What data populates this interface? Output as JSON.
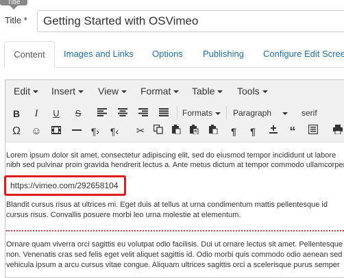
{
  "tooltip": {
    "text": "Title"
  },
  "title_field": {
    "label": "Title *",
    "value": "Getting Started with OSVimeo"
  },
  "tabs": [
    {
      "label": "Content",
      "active": true
    },
    {
      "label": "Images and Links",
      "active": false
    },
    {
      "label": "Options",
      "active": false
    },
    {
      "label": "Publishing",
      "active": false
    },
    {
      "label": "Configure Edit Screen",
      "active": false
    }
  ],
  "editor": {
    "menubar": [
      {
        "label": "Edit"
      },
      {
        "label": "Insert"
      },
      {
        "label": "View"
      },
      {
        "label": "Format"
      },
      {
        "label": "Table"
      },
      {
        "label": "Tools"
      }
    ],
    "toolbar": {
      "bold": "B",
      "italic": "I",
      "underline": "U",
      "strikethrough": "S",
      "formats_label": "Formats",
      "block_label": "Paragraph",
      "font_label": "serif"
    },
    "content": {
      "para1_line1": "Lorem ipsum dolor sit amet, consectetur adipiscing elit, sed do eiusmod tempor incididunt ut labore",
      "para1_line2": "nibh sed pulvinar proin gravida hendrerit lectus a. Ante metus dictum at tempor commodo ullamcorper",
      "link": "https://vimeo.com/292658104",
      "para2_line1": "Blandit cursus risus at ultrices mi. Eget duis at tellus at urna condimentum mattis pellentesque id",
      "para2_line2": "cursus risus. Convallis posuere morbi leo urna molestie at elementum.",
      "para3_line1": "Ornare quam viverra orci sagittis eu volutpat odio facilisis. Dui ut ornare lectus sit amet. Pellentesque",
      "para3_line2": "non. Venenatis cras sed felis eget velit aliquet sagittis id. Odio morbi quis commodo odio aenean sed",
      "para3_line3": "vehicula ipsum a arcu cursus vitae congue. Aliquam ultrices sagittis orci a scelerisque purus semper"
    }
  },
  "colors": {
    "link_highlight": "#e01b1b",
    "tab_link": "#1f6fb2",
    "pagebreak": "#d23c3c"
  }
}
